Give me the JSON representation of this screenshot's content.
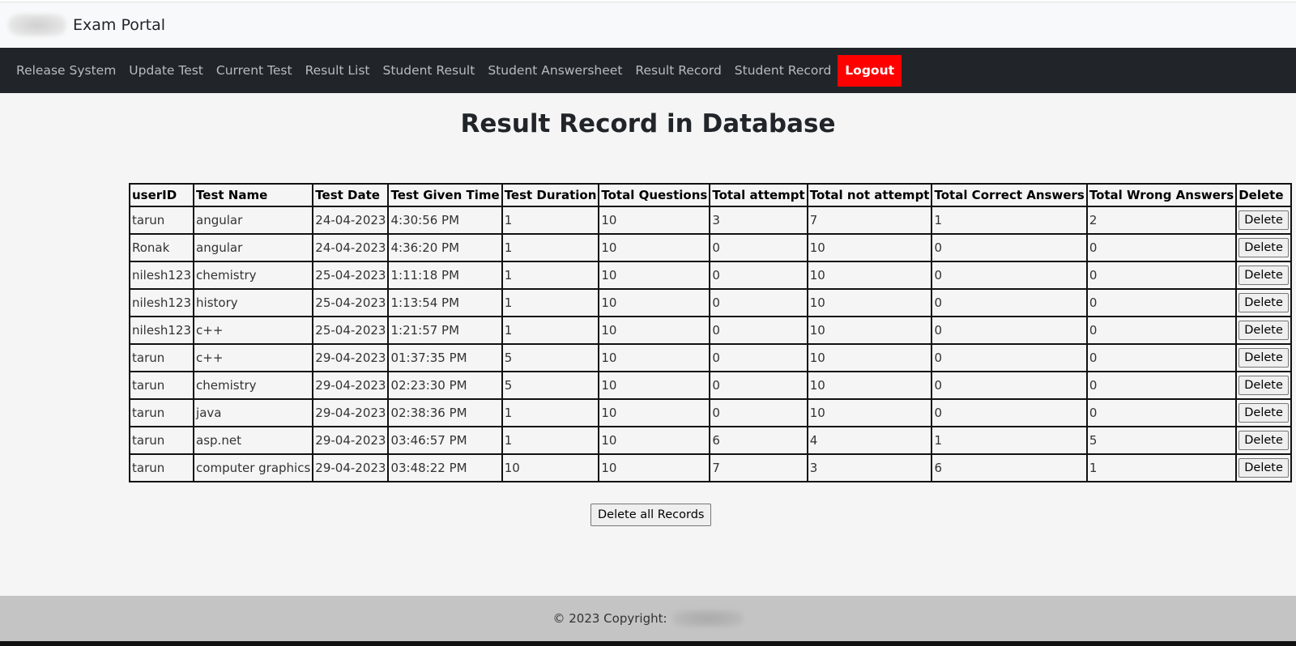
{
  "brand": {
    "title": "Exam Portal"
  },
  "nav": {
    "items": [
      {
        "label": "Release System"
      },
      {
        "label": "Update Test"
      },
      {
        "label": "Current Test"
      },
      {
        "label": "Result List"
      },
      {
        "label": "Student Result"
      },
      {
        "label": "Student Answersheet"
      },
      {
        "label": "Result Record"
      },
      {
        "label": "Student Record"
      }
    ],
    "logout_label": "Logout",
    "logout_color": "#ff0000",
    "bar_color": "#212529"
  },
  "main": {
    "title": "Result Record in Database",
    "table": {
      "headers": [
        "userID",
        "Test Name",
        "Test Date",
        "Test Given Time",
        "Test Duration",
        "Total Questions",
        "Total attempt",
        "Total not attempt",
        "Total Correct Answers",
        "Total Wrong Answers",
        "Delete"
      ],
      "rows": [
        [
          "tarun",
          "angular",
          "24-04-2023",
          "4:30:56 PM",
          "1",
          "10",
          "3",
          "7",
          "1",
          "2"
        ],
        [
          "Ronak",
          "angular",
          "24-04-2023",
          "4:36:20 PM",
          "1",
          "10",
          "0",
          "10",
          "0",
          "0"
        ],
        [
          "nilesh123",
          "chemistry",
          "25-04-2023",
          "1:11:18 PM",
          "1",
          "10",
          "0",
          "10",
          "0",
          "0"
        ],
        [
          "nilesh123",
          "history",
          "25-04-2023",
          "1:13:54 PM",
          "1",
          "10",
          "0",
          "10",
          "0",
          "0"
        ],
        [
          "nilesh123",
          "c++",
          "25-04-2023",
          "1:21:57 PM",
          "1",
          "10",
          "0",
          "10",
          "0",
          "0"
        ],
        [
          "tarun",
          "c++",
          "29-04-2023",
          "01:37:35 PM",
          "5",
          "10",
          "0",
          "10",
          "0",
          "0"
        ],
        [
          "tarun",
          "chemistry",
          "29-04-2023",
          "02:23:30 PM",
          "5",
          "10",
          "0",
          "10",
          "0",
          "0"
        ],
        [
          "tarun",
          "java",
          "29-04-2023",
          "02:38:36 PM",
          "1",
          "10",
          "0",
          "10",
          "0",
          "0"
        ],
        [
          "tarun",
          "asp.net",
          "29-04-2023",
          "03:46:57 PM",
          "1",
          "10",
          "6",
          "4",
          "1",
          "5"
        ],
        [
          "tarun",
          "computer graphics",
          "29-04-2023",
          "03:48:22 PM",
          "10",
          "10",
          "7",
          "3",
          "6",
          "1"
        ]
      ],
      "delete_label": "Delete"
    },
    "delete_all_label": "Delete all Records"
  },
  "footer": {
    "text": "© 2023 Copyright:"
  }
}
